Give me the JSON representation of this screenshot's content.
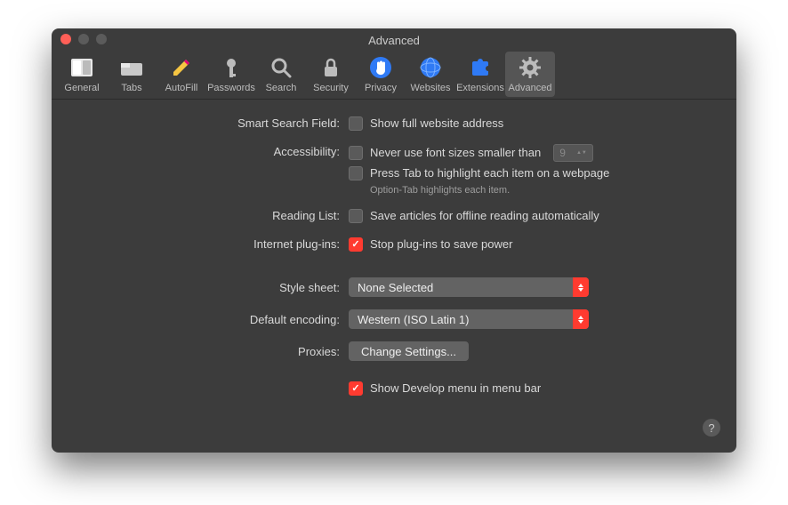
{
  "window": {
    "title": "Advanced"
  },
  "toolbar": {
    "items": [
      {
        "label": "General"
      },
      {
        "label": "Tabs"
      },
      {
        "label": "AutoFill"
      },
      {
        "label": "Passwords"
      },
      {
        "label": "Search"
      },
      {
        "label": "Security"
      },
      {
        "label": "Privacy"
      },
      {
        "label": "Websites"
      },
      {
        "label": "Extensions"
      },
      {
        "label": "Advanced"
      }
    ]
  },
  "sections": {
    "smart_search": {
      "label": "Smart Search Field:",
      "opt": "Show full website address"
    },
    "accessibility": {
      "label": "Accessibility:",
      "font_size": "Never use font sizes smaller than",
      "font_value": "9",
      "press_tab": "Press Tab to highlight each item on a webpage",
      "hint": "Option-Tab highlights each item."
    },
    "reading_list": {
      "label": "Reading List:",
      "opt": "Save articles for offline reading automatically"
    },
    "plugins": {
      "label": "Internet plug-ins:",
      "opt": "Stop plug-ins to save power"
    },
    "style_sheet": {
      "label": "Style sheet:",
      "value": "None Selected"
    },
    "encoding": {
      "label": "Default encoding:",
      "value": "Western (ISO Latin 1)"
    },
    "proxies": {
      "label": "Proxies:",
      "button": "Change Settings..."
    },
    "develop": {
      "opt": "Show Develop menu in menu bar"
    }
  },
  "help": "?"
}
